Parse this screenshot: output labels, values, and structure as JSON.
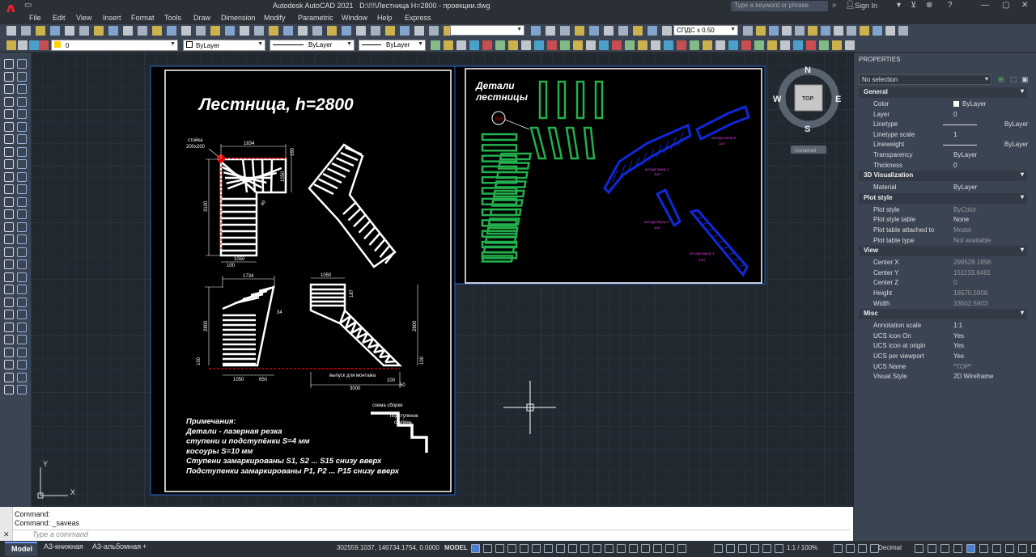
{
  "app": {
    "title": "Autodesk AutoCAD 2021",
    "path": "D:\\!!!\\Лестница H=2800 - проекции.dwg",
    "search_placeholder": "Type a keyword or phrase",
    "user": "Sign In"
  },
  "menu": [
    "File",
    "Edit",
    "View",
    "Insert",
    "Format",
    "Tools",
    "Draw",
    "Dimension",
    "Modify",
    "Parametric",
    "Window",
    "Help",
    "Express"
  ],
  "toolbar": {
    "scale": "СПДС x 0.50",
    "layer": "0",
    "color": "ByLayer",
    "linetype": "ByLayer",
    "lineweight": "ByLayer"
  },
  "viewcube": {
    "north": "N",
    "south": "S",
    "east": "E",
    "west": "W",
    "face": "TOP",
    "ucs": "Unnamed"
  },
  "drawing": {
    "sheet1_title": "Лестница, h=2800",
    "post_label": "стойка\n200x200",
    "notes": [
      "Примечания:",
      "Детали - лазерная резка",
      "ступени и подступёнки S=4 мм",
      "косоуры S=10 мм",
      "Ступени замаркированы S1, S2 ... S15 снизу вверх",
      "Подступенки замаркированы P1, P2 ... P15 снизу вверх"
    ],
    "scheme_labels": [
      "схема сборки",
      "подступенок",
      "ступень"
    ],
    "exit_label": "выпуск для монтажа",
    "dims": {
      "d1834": "1834",
      "d100a": "100",
      "d1050a": "1050",
      "d3100": "3100",
      "d1050b": "1050",
      "d100b": "100",
      "d1734": "1734",
      "d2800a": "2800",
      "d100c": "100",
      "d34": "34",
      "d1050c": "1050",
      "d650": "650",
      "d1050d": "1050",
      "d187": "187",
      "d2800b": "2800",
      "d100d": "100",
      "d3000": "3000",
      "d50": "50",
      "d40": "40"
    },
    "sheet2_title": "Детали\nлестницы",
    "sheet2_marker": "S15",
    "kosour_labels": [
      "косоур внеш.2",
      "1шт",
      "косоур внеш.1",
      "1шт",
      "косоур внутр.2",
      "1шт",
      "косоур внутр.1",
      "1шт"
    ]
  },
  "properties": {
    "header": "PROPERTIES",
    "selection": "No selection",
    "sections": [
      {
        "name": "General",
        "rows": [
          [
            "Color",
            "ByLayer"
          ],
          [
            "Layer",
            "0"
          ],
          [
            "Linetype",
            "ByLayer"
          ],
          [
            "Linetype scale",
            "1"
          ],
          [
            "Lineweight",
            "ByLayer"
          ],
          [
            "Transparency",
            "ByLayer"
          ],
          [
            "Thickness",
            "0"
          ]
        ]
      },
      {
        "name": "3D Visualization",
        "rows": [
          [
            "Material",
            "ByLayer"
          ]
        ]
      },
      {
        "name": "Plot style",
        "rows": [
          [
            "Plot style",
            "ByColor"
          ],
          [
            "Plot style table",
            "None"
          ],
          [
            "Plot table attached to",
            "Model"
          ],
          [
            "Plot table type",
            "Not available"
          ]
        ]
      },
      {
        "name": "View",
        "rows": [
          [
            "Center X",
            "299528.1896"
          ],
          [
            "Center Y",
            "151133.6481"
          ],
          [
            "Center Z",
            "0"
          ],
          [
            "Height",
            "16570.5908"
          ],
          [
            "Width",
            "33502.5903"
          ]
        ]
      },
      {
        "name": "Misc",
        "rows": [
          [
            "Annotation scale",
            "1:1"
          ],
          [
            "UCS icon On",
            "Yes"
          ],
          [
            "UCS icon at origin",
            "Yes"
          ],
          [
            "UCS per viewport",
            "Yes"
          ],
          [
            "UCS Name",
            "*TOP*"
          ],
          [
            "Visual Style",
            "2D Wireframe"
          ]
        ]
      }
    ]
  },
  "command": {
    "line1": "Command:",
    "line2": "Command: _saveas",
    "placeholder": "Type a command"
  },
  "status": {
    "tabs": [
      "Model",
      "A3-книжная",
      "A3-альбомная"
    ],
    "coords": "302559.1037, 146734.1754, 0.0000",
    "model": "MODEL",
    "scale": "1:1 / 100%",
    "units": "Decimal"
  },
  "colors": {
    "accent": "#e5202a",
    "canvas": "#212830",
    "panel": "#3b4453"
  }
}
